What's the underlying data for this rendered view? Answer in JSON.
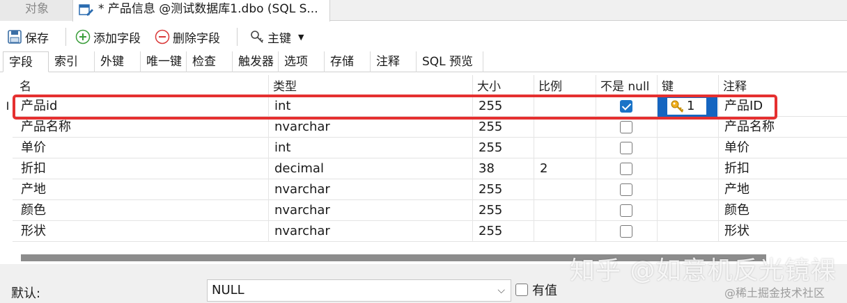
{
  "doc_tabs": {
    "objects_label": "对象",
    "active_label": "* 产品信息 @测试数据库1.dbo (SQL S..."
  },
  "toolbar": {
    "save_label": "保存",
    "add_field_label": "添加字段",
    "delete_field_label": "删除字段",
    "primary_key_label": "主键"
  },
  "sub_tabs": [
    "字段",
    "索引",
    "外键",
    "唯一键",
    "检查",
    "触发器",
    "选项",
    "存储",
    "注释",
    "SQL 预览"
  ],
  "columns": [
    "名",
    "类型",
    "大小",
    "比例",
    "不是 null",
    "键",
    "注释"
  ],
  "rows": [
    {
      "name": "产品id",
      "type": "int",
      "size": "255",
      "scale": "",
      "not_null": true,
      "key": "1",
      "comment": "产品ID"
    },
    {
      "name": "产品名称",
      "type": "nvarchar",
      "size": "255",
      "scale": "",
      "not_null": false,
      "key": "",
      "comment": "产品名称"
    },
    {
      "name": "单价",
      "type": "int",
      "size": "255",
      "scale": "",
      "not_null": false,
      "key": "",
      "comment": "单价"
    },
    {
      "name": "折扣",
      "type": "decimal",
      "size": "38",
      "scale": "2",
      "not_null": false,
      "key": "",
      "comment": "折扣"
    },
    {
      "name": "产地",
      "type": "nvarchar",
      "size": "255",
      "scale": "",
      "not_null": false,
      "key": "",
      "comment": "产地"
    },
    {
      "name": "颜色",
      "type": "nvarchar",
      "size": "255",
      "scale": "",
      "not_null": false,
      "key": "",
      "comment": "颜色"
    },
    {
      "name": "形状",
      "type": "nvarchar",
      "size": "255",
      "scale": "",
      "not_null": false,
      "key": "",
      "comment": "形状"
    }
  ],
  "default": {
    "label": "默认:",
    "value": "NULL",
    "has_value_label": "有值"
  },
  "watermark": {
    "main": "知乎 @如意机反光镜裸",
    "sub": "@稀土掘金技术社区"
  },
  "colors": {
    "accent": "#1565c0",
    "highlight": "#e53030"
  }
}
